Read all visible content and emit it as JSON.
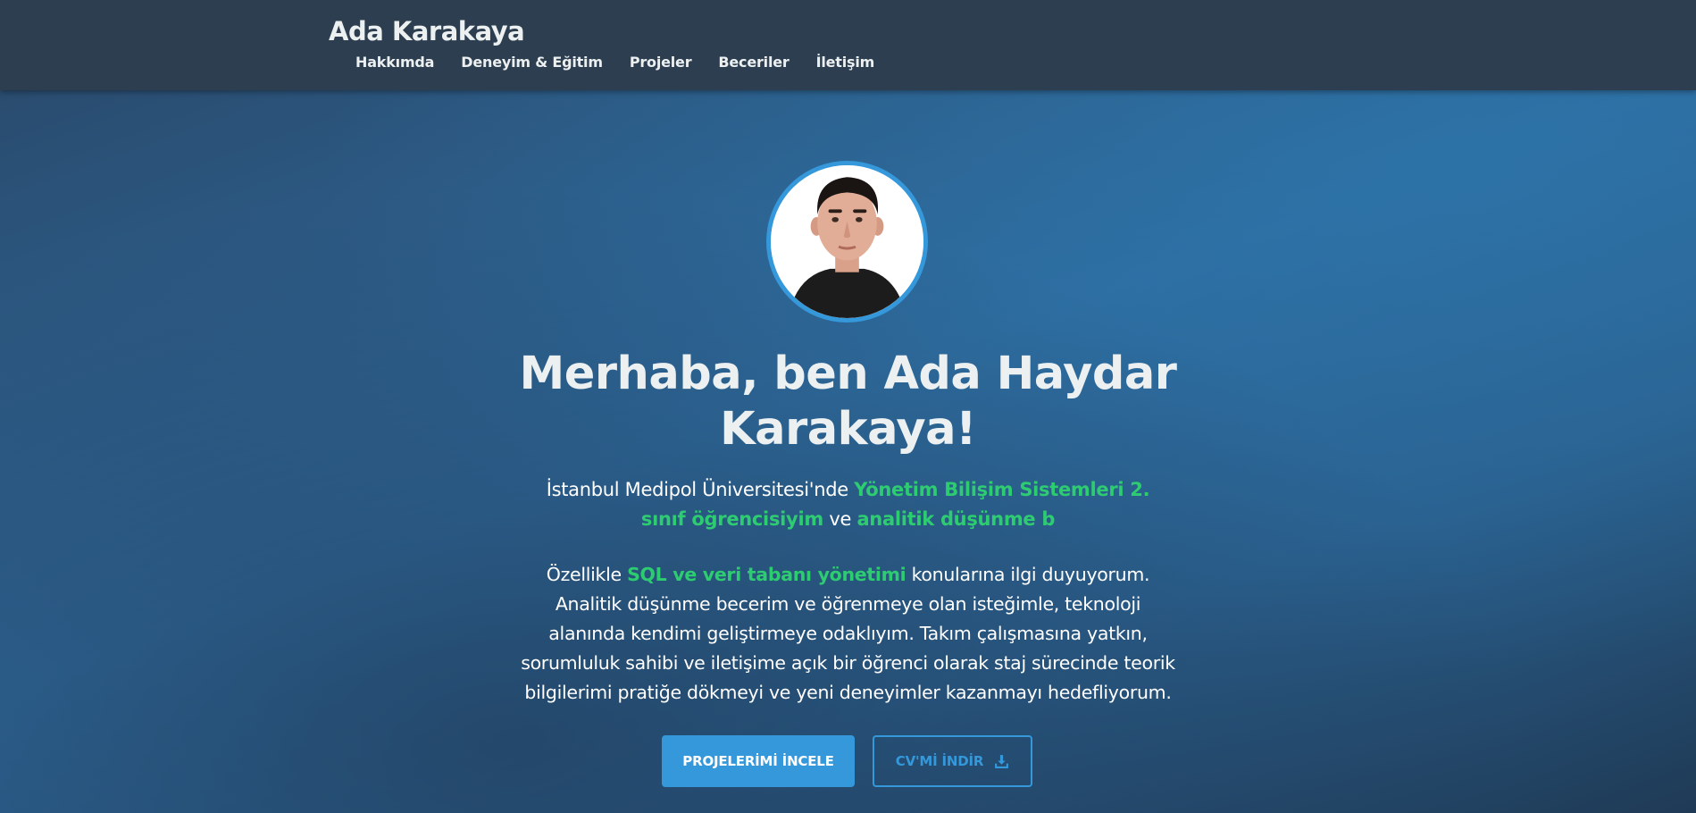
{
  "header": {
    "brand": "Ada Karakaya",
    "nav": [
      {
        "label": "Hakkımda"
      },
      {
        "label": "Deneyim & Eğitim"
      },
      {
        "label": "Projeler"
      },
      {
        "label": "Beceriler"
      },
      {
        "label": "İletişim"
      }
    ]
  },
  "hero": {
    "title": "Merhaba, ben Ada Haydar Karakaya!",
    "subtitle": {
      "part1": "İstanbul Medipol Üniversitesi'nde ",
      "highlight1": "Yönetim Bilişim Sistemleri 2. sınıf öğrencisiyim",
      "part2": " ve ",
      "highlight2": "analitik düşünme b"
    },
    "bio": {
      "part1": "Özellikle ",
      "highlight": "SQL ve veri tabanı yönetimi",
      "part2": " konularına ilgi duyuyorum. Analitik düşünme becerim ve öğrenmeye olan isteğimle, teknoloji alanında kendimi geliştirmeye odaklıyım. Takım çalışmasına yatkın, sorumluluk sahibi ve iletişime açık bir öğrenci olarak staj sürecinde teorik bilgilerimi pratiğe dökmeyi ve yeni deneyimler kazanmayı hedefliyorum."
    },
    "buttons": {
      "projects": "PROJELERİMİ İNCELE",
      "cv": "CV'Mİ İNDİR"
    },
    "avatar_alt": "profile-photo"
  },
  "colors": {
    "navbar": "#2c3e50",
    "accent": "#3498db",
    "highlight": "#2ecc71",
    "text": "#ecf0f1"
  },
  "icons": {
    "cv_button": "download-icon"
  }
}
